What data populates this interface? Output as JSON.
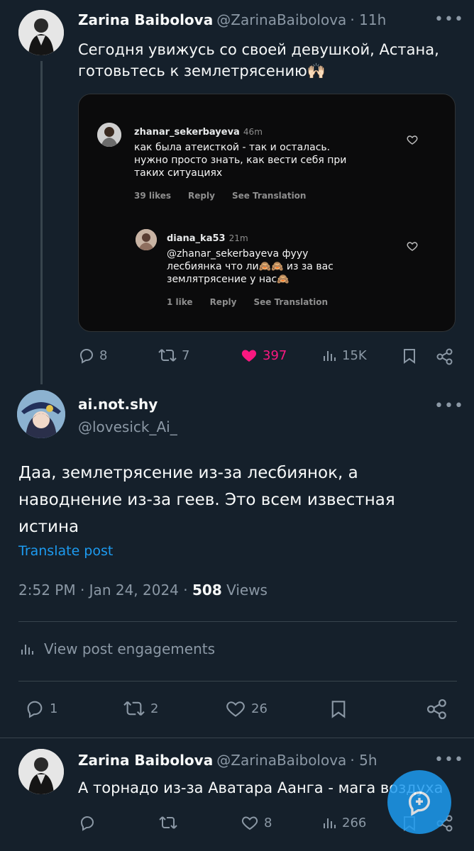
{
  "tweet1": {
    "name": "Zarina Baibolova",
    "handle": "@ZarinaBaibolova",
    "time": "· 11h",
    "text_line1": "Сегодня увижусь со своей девушкой, Астана,",
    "text_line2": "готовьтесь к землетрясению🙌🏻",
    "embed": {
      "comment1": {
        "user": "zhanar_sekerbayeva",
        "time": "46m",
        "line1": "как была атеисткой - так и осталась.",
        "line2": "нужно просто знать, как вести себя при",
        "line3": "таких ситуациях",
        "likes": "39 likes",
        "reply": "Reply",
        "translation": "See Translation"
      },
      "comment2": {
        "user": "diana_ka53",
        "time": "21m",
        "line1": "@zhanar_sekerbayeva фууу",
        "line2": "лесбиянка что ли🙈🙈 из за вас",
        "line3": "землятрясение у нас🙈",
        "likes": "1 like",
        "reply": "Reply",
        "translation": "See Translation"
      }
    },
    "actions": {
      "replies": "8",
      "reposts": "7",
      "likes": "397",
      "views": "15K"
    }
  },
  "tweet2": {
    "name": "ai.not.shy",
    "handle": "@lovesick_Ai_",
    "text_line1": "Даа, землетрясение из-за лесбиянок, а",
    "text_line2": "наводнение из-за геев. Это всем известная",
    "text_line3": "истина",
    "translate": "Translate post",
    "time": "2:52 PM · Jan 24, 2024 · ",
    "views_count": "508",
    "views_label": " Views",
    "engagements": "View post engagements",
    "actions": {
      "replies": "1",
      "reposts": "2",
      "likes": "26"
    }
  },
  "tweet3": {
    "name": "Zarina Baibolova",
    "handle": "@ZarinaBaibolova",
    "time": "· 5h",
    "text": "А торнадо из-за Аватара Аанга - мага воздуха",
    "actions": {
      "likes": "8",
      "views": "266"
    }
  },
  "menu_dots": "•••",
  "colors": {
    "background": "#15202b",
    "accent": "#1d9bf0",
    "like": "#f91880",
    "muted": "#8b98a5"
  }
}
